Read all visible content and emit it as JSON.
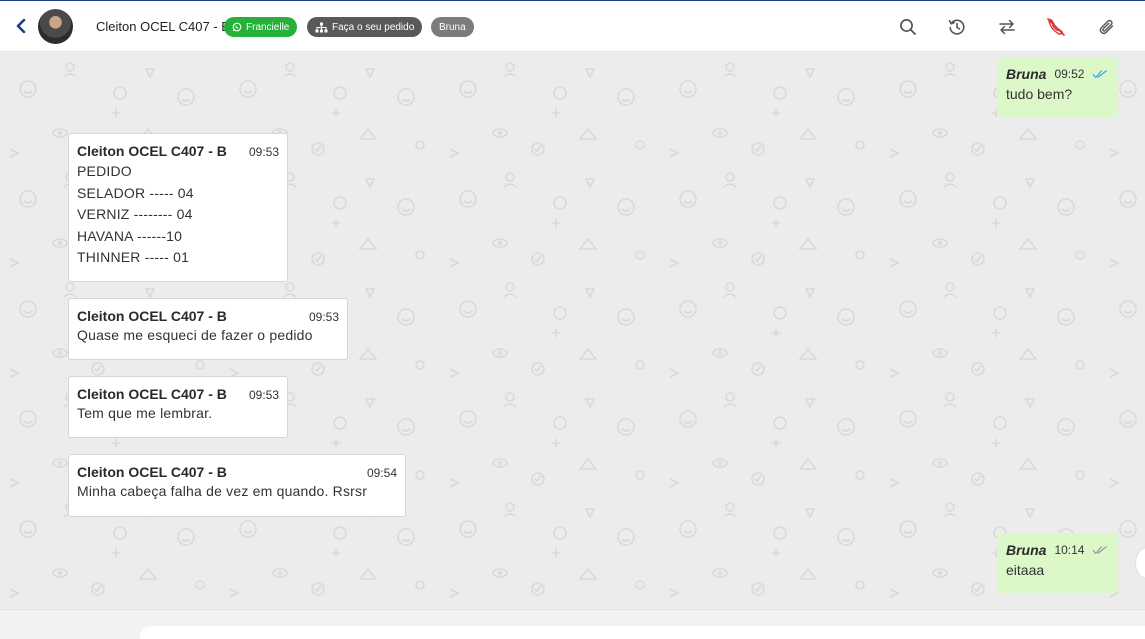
{
  "header": {
    "contact_name": "Cleiton OCEL C407 - B",
    "tags": {
      "channel": "Francielle",
      "order": "Faça o seu pedido",
      "user": "Bruna"
    },
    "icons": [
      "back-icon",
      "search-icon",
      "history-icon",
      "transfer-icon",
      "hangup-phone-icon",
      "attach-icon"
    ]
  },
  "colors": {
    "whatsapp_tag": "#25b03a",
    "order_tag": "#595959",
    "user_tag": "#7b7b7b",
    "outgoing_bubble": "#ddf8c8",
    "incoming_bubble": "#ffffff",
    "hangup_icon": "#e03131",
    "read_tick": "#3aa8e8"
  },
  "messages": [
    {
      "direction": "out",
      "author": "Bruna",
      "time": "09:52",
      "lines": [
        "tudo bem?"
      ],
      "status": "read"
    },
    {
      "direction": "in",
      "author": "Cleiton OCEL C407 - B",
      "time": "09:53",
      "lines": [
        "PEDIDO",
        "SELADOR ----- 04",
        "VERNIZ -------- 04",
        "HAVANA ------10",
        "THINNER ----- 01"
      ]
    },
    {
      "direction": "in",
      "author": "Cleiton OCEL C407 - B",
      "time": "09:53",
      "lines": [
        "Quase me esqueci de fazer o pedido"
      ]
    },
    {
      "direction": "in",
      "author": "Cleiton OCEL C407 - B",
      "time": "09:53",
      "lines": [
        "Tem que me lembrar."
      ]
    },
    {
      "direction": "in",
      "author": "Cleiton OCEL C407 - B",
      "time": "09:54",
      "lines": [
        "Minha cabeça falha de vez em quando. Rsrsr"
      ]
    },
    {
      "direction": "out",
      "author": "Bruna",
      "time": "10:14",
      "lines": [
        "eitaaa"
      ],
      "status": "delivered"
    }
  ]
}
